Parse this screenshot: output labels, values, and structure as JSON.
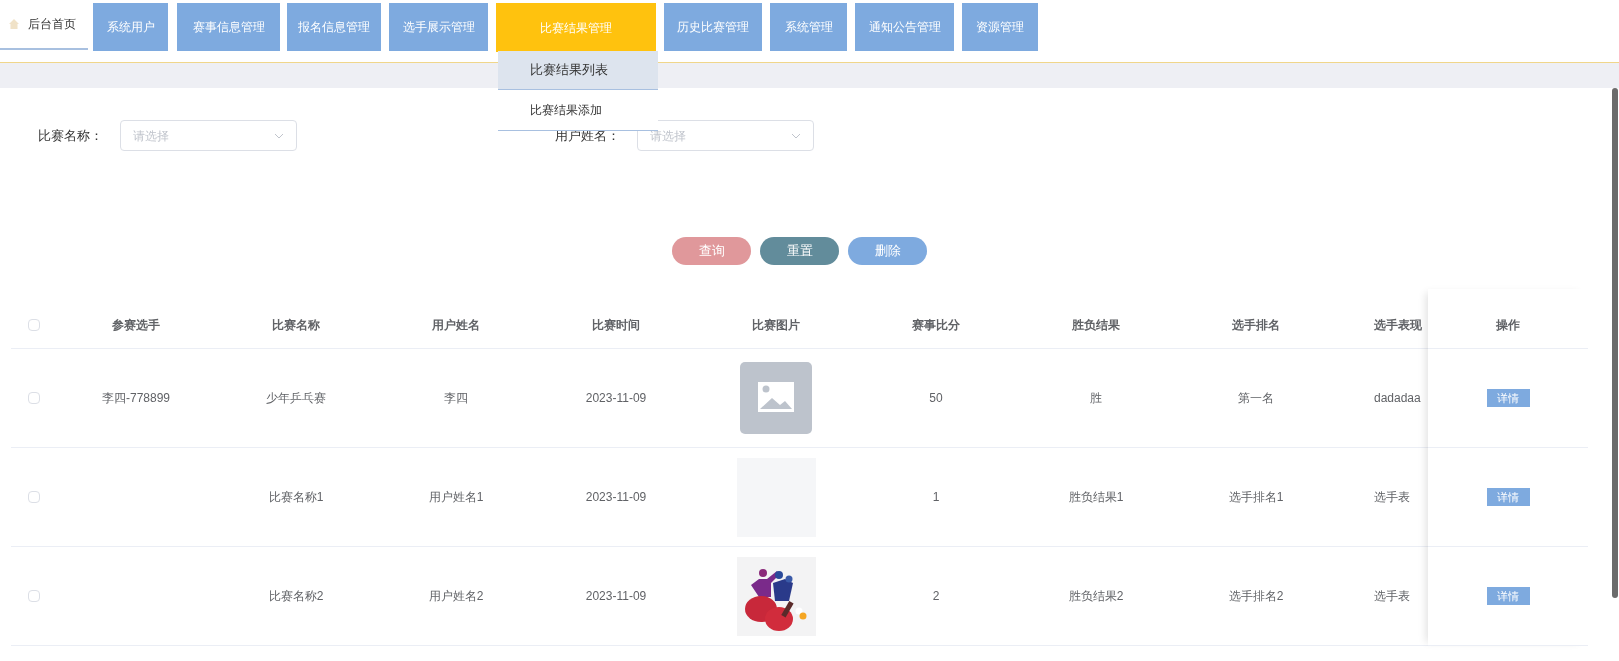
{
  "nav": {
    "home": {
      "label": "后台首页",
      "selected": true
    },
    "items": [
      {
        "label": "系统用户",
        "selected": false
      },
      {
        "label": "赛事信息管理",
        "selected": false
      },
      {
        "label": "报名信息管理",
        "selected": false
      },
      {
        "label": "选手展示管理",
        "selected": false
      },
      {
        "label": "比赛结果管理",
        "selected": true
      },
      {
        "label": "历史比赛管理",
        "selected": false
      },
      {
        "label": "系统管理",
        "selected": false
      },
      {
        "label": "通知公告管理",
        "selected": false
      },
      {
        "label": "资源管理",
        "selected": false
      }
    ],
    "dropdown": [
      {
        "label": "比赛结果列表",
        "selected": true
      },
      {
        "label": "比赛结果添加",
        "selected": false
      }
    ]
  },
  "filters": [
    {
      "label": "比赛名称：",
      "placeholder": "请选择"
    },
    {
      "label": "用户姓名：",
      "placeholder": "请选择"
    }
  ],
  "actions": [
    {
      "label": "查询",
      "kind": "query"
    },
    {
      "label": "重置",
      "kind": "reset"
    },
    {
      "label": "删除",
      "kind": "delete"
    }
  ],
  "table": {
    "select_all": {
      "checked": false
    },
    "columns": [
      "参赛选手",
      "比赛名称",
      "用户姓名",
      "比赛时间",
      "比赛图片",
      "赛事比分",
      "胜负结果",
      "选手排名",
      "选手表现",
      "操作"
    ],
    "rows": [
      {
        "checked": false,
        "cells": [
          "李四-778899",
          "少年乒乓赛",
          "李四",
          "2023-11-09"
        ],
        "image": {
          "kind": "placeholder"
        },
        "cells2": [
          "50",
          "胜",
          "第一名",
          "dadadaa"
        ],
        "button": "详情"
      },
      {
        "checked": false,
        "cells": [
          "",
          "比赛名称1",
          "用户姓名1",
          "2023-11-09"
        ],
        "image": {
          "kind": "blank"
        },
        "cells2": [
          "1",
          "胜负结果1",
          "选手排名1",
          "选手表"
        ],
        "button": "详情"
      },
      {
        "checked": false,
        "cells": [
          "",
          "比赛名称2",
          "用户姓名2",
          "2023-11-09"
        ],
        "cells2": [
          "2",
          "胜负结果2",
          "选手排名2",
          "选手表"
        ],
        "button": "详情"
      }
    ]
  }
}
